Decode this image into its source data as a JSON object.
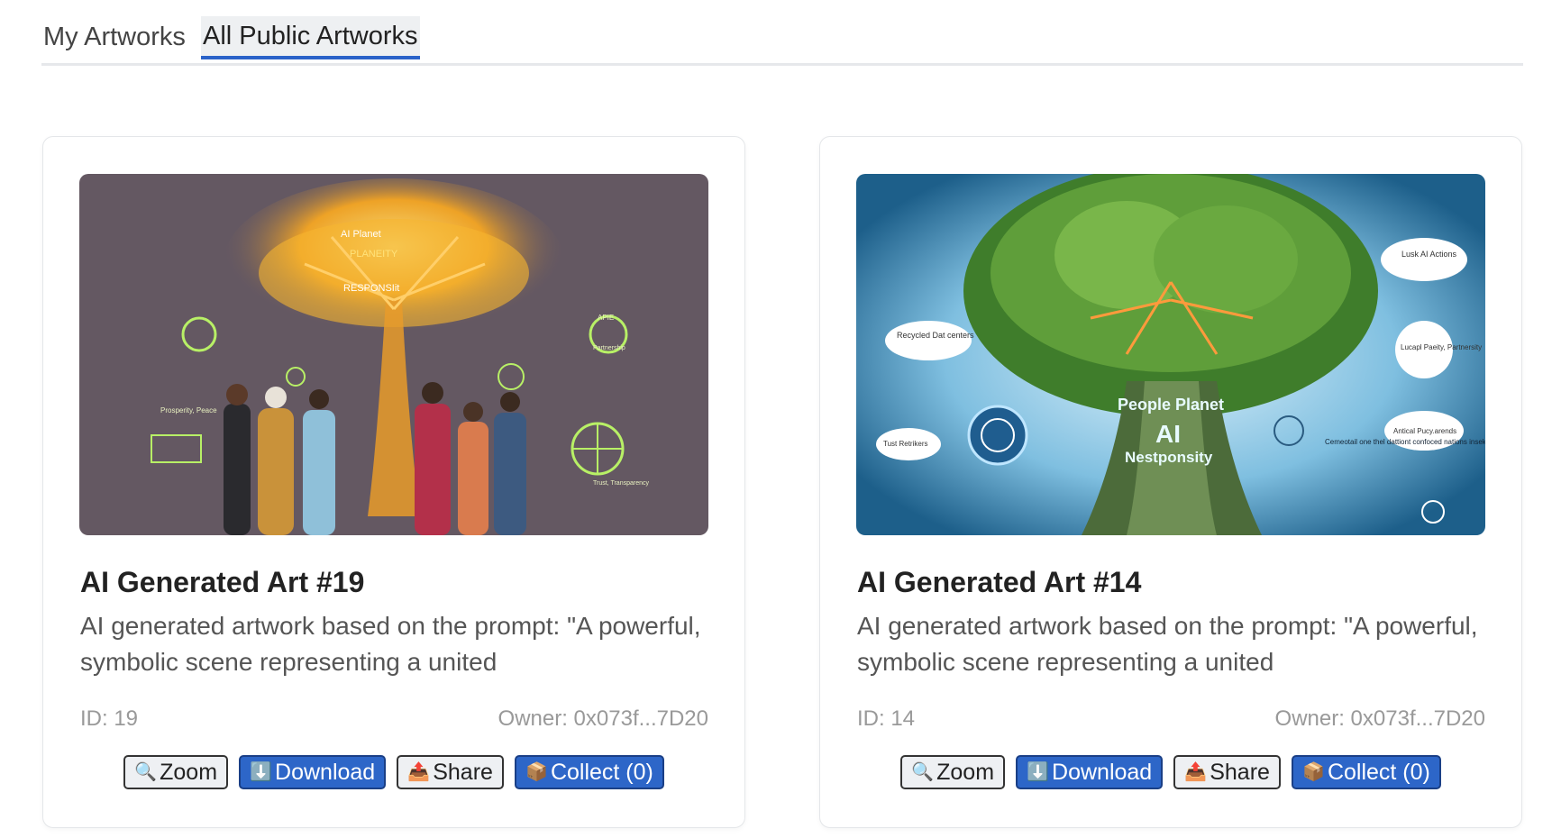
{
  "tabs": [
    {
      "label": "My Artworks",
      "active": false
    },
    {
      "label": "All Public Artworks",
      "active": true
    }
  ],
  "colors": {
    "accent": "#2a62c9",
    "button_blue": "#2d66c8"
  },
  "cards": [
    {
      "title": "AI Generated Art #19",
      "description": "AI generated artwork based on the prompt: \"A powerful, symbolic scene representing a united",
      "id_text": "ID: 19",
      "owner_text": "Owner: 0x073f...7D20",
      "art_labels": [
        "AI Planet",
        "PLANEITY",
        "RESPONSIit",
        "Prosperity, Peace",
        "APIE",
        "Partnership",
        "Trust, Transparency"
      ],
      "buttons": {
        "zoom": "Zoom",
        "download": "Download",
        "share": "Share",
        "collect": "Collect (0)"
      }
    },
    {
      "title": "AI Generated Art #14",
      "description": "AI generated artwork based on the prompt: \"A powerful, symbolic scene representing a united",
      "id_text": "ID: 14",
      "owner_text": "Owner: 0x073f...7D20",
      "art_labels": [
        "People Planet",
        "AI",
        "Nestponsity",
        "Recycled Dat centers",
        "Lusk AI Actions",
        "Lucapl Paeity, Partnersity",
        "Tust Retrikers",
        "Antical Pucy.arends",
        "Cemeotail one thel dattiont confoced nations insektigentry"
      ],
      "buttons": {
        "zoom": "Zoom",
        "download": "Download",
        "share": "Share",
        "collect": "Collect (0)"
      }
    }
  ],
  "icons": {
    "zoom": "magnifier-icon",
    "download": "download-arrow-icon",
    "share": "outbox-tray-icon",
    "collect": "package-icon"
  }
}
